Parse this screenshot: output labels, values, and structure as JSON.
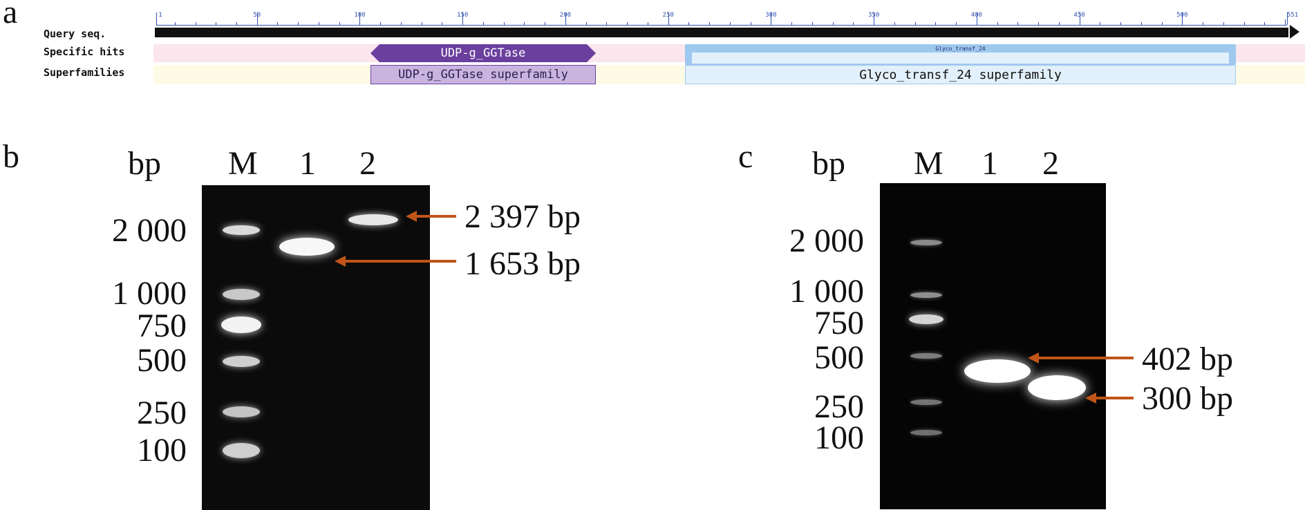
{
  "panel_a": {
    "letter": "a",
    "rows": [
      "Query seq.",
      "Specific hits",
      "Superfamilies"
    ],
    "ruler_ticks": [
      "1",
      "50",
      "100",
      "150",
      "200",
      "250",
      "300",
      "350",
      "400",
      "450",
      "500",
      "551"
    ],
    "specific_hits": [
      {
        "label": "UDP-g_GGTase",
        "color": "#6a3f9e"
      },
      {
        "label": "Glyco_transf_24",
        "color": "#9ec8ee"
      }
    ],
    "superfamilies": [
      {
        "label": "UDP-g_GGTase superfamily",
        "color": "#c9b4e0"
      },
      {
        "label": "Glyco_transf_24 superfamily",
        "color": "#e2f0fb"
      }
    ]
  },
  "panel_b": {
    "letter": "b",
    "unit": "bp",
    "lanes": [
      "M",
      "1",
      "2"
    ],
    "ladder": [
      "2 000",
      "1 000",
      "750",
      "500",
      "250",
      "100"
    ],
    "annotations": [
      "2 397 bp",
      "1 653 bp"
    ]
  },
  "panel_c": {
    "letter": "c",
    "unit": "bp",
    "lanes": [
      "M",
      "1",
      "2"
    ],
    "ladder": [
      "2 000",
      "1 000",
      "750",
      "500",
      "250",
      "100"
    ],
    "annotations": [
      "402 bp",
      "300 bp"
    ]
  },
  "colors": {
    "arrow": "#c0551a",
    "gel": "#0b0b0b"
  }
}
